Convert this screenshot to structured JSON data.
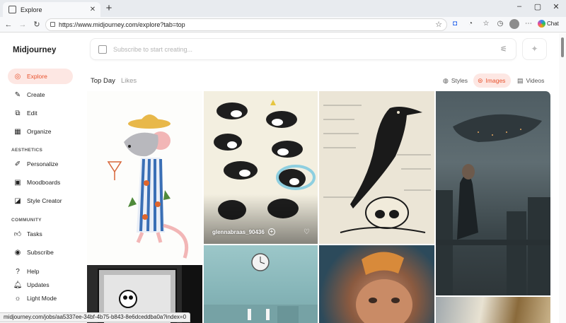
{
  "browser": {
    "tab_title": "Explore",
    "url": "https://www.midjourney.com/explore?tab=top",
    "chat_label": "Chat",
    "status_url": "midjourney.com/jobs/aa5337ee-34bf-4b75-b843-8e6dceddba0a?index=0"
  },
  "sidebar": {
    "brand": "Midjourney",
    "main_items": [
      {
        "label": "Explore",
        "icon": "compass-icon"
      },
      {
        "label": "Create",
        "icon": "pencil-icon"
      },
      {
        "label": "Edit",
        "icon": "edit-icon"
      },
      {
        "label": "Organize",
        "icon": "grid-icon"
      }
    ],
    "aesthetics_heading": "AESTHETICS",
    "aesthetics_items": [
      {
        "label": "Personalize",
        "icon": "pencil-square-icon"
      },
      {
        "label": "Moodboards",
        "icon": "moodboard-icon"
      },
      {
        "label": "Style Creator",
        "icon": "palette-icon"
      }
    ],
    "community_heading": "COMMUNITY",
    "community_items": [
      {
        "label": "Tasks",
        "icon": "thumbs-up-icon"
      },
      {
        "label": "Subscribe",
        "icon": "user-circle-icon"
      }
    ],
    "footer_items": [
      {
        "label": "Help",
        "icon": "help-icon"
      },
      {
        "label": "Updates",
        "icon": "bell-icon"
      },
      {
        "label": "Light Mode",
        "icon": "sun-icon"
      }
    ]
  },
  "search": {
    "placeholder": "Subscribe to start creating..."
  },
  "explore": {
    "tabs": [
      "Top Day",
      "Likes"
    ],
    "filters": [
      {
        "label": "Styles",
        "icon": "palette-icon",
        "active": false
      },
      {
        "label": "Images",
        "icon": "image-icon",
        "active": true
      },
      {
        "label": "Videos",
        "icon": "film-icon",
        "active": false
      }
    ],
    "hovered_item": {
      "username": "glennabraas_90436"
    }
  },
  "colors": {
    "accent": "#e8512c",
    "accent_bg": "#fde7e3"
  }
}
